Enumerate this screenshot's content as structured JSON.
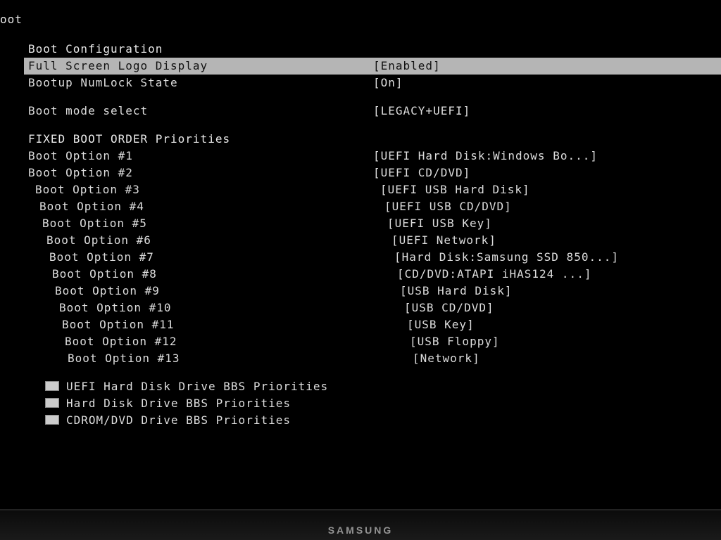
{
  "tab": "oot",
  "section_header": "Boot Configuration",
  "settings": {
    "full_screen_logo": {
      "label": "Full Screen Logo Display",
      "value": "[Enabled]"
    },
    "numlock": {
      "label": "Bootup NumLock State",
      "value": "[On]"
    },
    "boot_mode": {
      "label": "Boot mode select",
      "value": "[LEGACY+UEFI]"
    }
  },
  "fixed_boot_order_header": "FIXED BOOT ORDER Priorities",
  "boot_options": [
    {
      "label": "Boot Option #1",
      "value": "[UEFI Hard Disk:Windows Bo...]"
    },
    {
      "label": "Boot Option #2",
      "value": "[UEFI CD/DVD]"
    },
    {
      "label": "Boot Option #3",
      "value": "[UEFI USB Hard Disk]"
    },
    {
      "label": "Boot Option #4",
      "value": "[UEFI USB CD/DVD]"
    },
    {
      "label": "Boot Option #5",
      "value": "[UEFI USB Key]"
    },
    {
      "label": "Boot Option #6",
      "value": "[UEFI Network]"
    },
    {
      "label": "Boot Option #7",
      "value": "[Hard Disk:Samsung SSD 850...]"
    },
    {
      "label": "Boot Option #8",
      "value": "[CD/DVD:ATAPI   iHAS124   ...]"
    },
    {
      "label": "Boot Option #9",
      "value": "[USB Hard Disk]"
    },
    {
      "label": "Boot Option #10",
      "value": "[USB CD/DVD]"
    },
    {
      "label": "Boot Option #11",
      "value": "[USB Key]"
    },
    {
      "label": "Boot Option #12",
      "value": "[USB Floppy]"
    },
    {
      "label": "Boot Option #13",
      "value": "[Network]"
    }
  ],
  "bbs": [
    "UEFI Hard Disk Drive BBS Priorities",
    "Hard Disk Drive BBS Priorities",
    "CDROM/DVD Drive BBS Priorities"
  ],
  "monitor_brand": "SAMSUNG"
}
